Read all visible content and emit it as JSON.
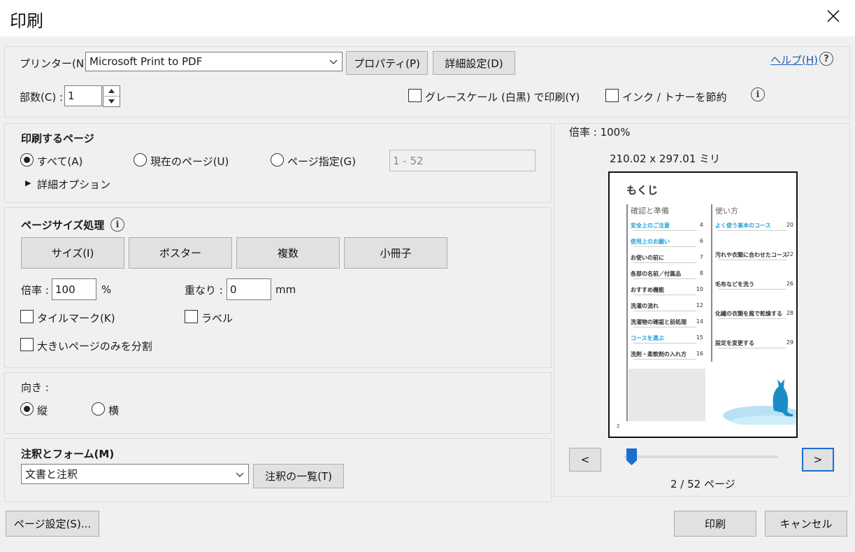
{
  "window": {
    "title": "印刷",
    "close_glyph": "✕"
  },
  "printer": {
    "label": "プリンター(N) :",
    "selected": "Microsoft Print to PDF",
    "properties_button": "プロパティ(P)",
    "advanced_button": "詳細設定(D)",
    "help_link": "ヘルプ(H)",
    "help_glyph": "?"
  },
  "copies": {
    "label": "部数(C) :",
    "value": "1"
  },
  "options": {
    "grayscale_label": "グレースケール (白黒) で印刷(Y)",
    "grayscale_checked": false,
    "save_ink_label": "インク / トナーを節約",
    "save_ink_checked": false,
    "info_glyph": "i"
  },
  "pages_to_print": {
    "heading": "印刷するページ",
    "all_label": "すべて(A)",
    "current_label": "現在のページ(U)",
    "range_label": "ページ指定(G)",
    "range_value": "1 - 52",
    "selected": "all",
    "more_options_label": "詳細オプション",
    "more_options_glyph": "▶"
  },
  "page_sizing": {
    "heading": "ページサイズ処理",
    "tabs": [
      "サイズ(I)",
      "ポスター",
      "複数",
      "小冊子"
    ],
    "scale_label": "倍率 :",
    "scale_value": "100",
    "scale_unit": "%",
    "overlap_label": "重なり :",
    "overlap_value": "0",
    "overlap_unit": "mm",
    "tile_marks_label": "タイルマーク(K)",
    "labels_label": "ラベル",
    "split_large_label": "大きいページのみを分割"
  },
  "orientation": {
    "heading": "向き :",
    "portrait_label": "縦",
    "landscape_label": "横",
    "selected": "portrait"
  },
  "comments": {
    "heading": "注釈とフォーム(M)",
    "selected": "文書と注釈",
    "summarize_button": "注釈の一覧(T)"
  },
  "preview": {
    "zoom_label": "倍率 : 100%",
    "dimensions": "210.02 x 297.01 ミリ",
    "prev_button": "<",
    "next_button": ">",
    "page_indicator": "2 / 52 ページ",
    "slider_position": 0.05,
    "page_number": "2",
    "doc": {
      "title": "もくじ",
      "left_heading": "確認と準備",
      "right_heading": "使い方",
      "left_items": [
        {
          "text": "安全上のご注意",
          "page": "4",
          "cyan": true
        },
        {
          "text": "使用上のお願い",
          "page": "6",
          "cyan": true
        },
        {
          "text": "お使いの前に",
          "page": "7",
          "cyan": false
        },
        {
          "text": "各部の名前／付属品",
          "page": "8",
          "cyan": false
        },
        {
          "text": "おすすめ機能",
          "page": "10",
          "cyan": false
        },
        {
          "text": "洗濯の流れ",
          "page": "12",
          "cyan": false
        },
        {
          "text": "洗濯物の確認と前処理",
          "page": "14",
          "cyan": false
        },
        {
          "text": "コースを選ぶ",
          "page": "15",
          "cyan": true
        },
        {
          "text": "洗剤・柔軟剤の入れ方",
          "page": "16",
          "cyan": false
        }
      ],
      "right_items": [
        {
          "text": "よく使う基本のコース",
          "page": "20",
          "cyan": true
        },
        {
          "text": "汚れや衣類に合わせたコース",
          "page": "22",
          "cyan": false
        },
        {
          "text": "毛布などを洗う",
          "page": "26",
          "cyan": false
        },
        {
          "text": "化繊の衣類を風で乾燥する",
          "page": "28",
          "cyan": false
        },
        {
          "text": "設定を変更する",
          "page": "29",
          "cyan": false
        }
      ]
    }
  },
  "footer": {
    "page_setup_button": "ページ設定(S)...",
    "print_button": "印刷",
    "cancel_button": "キャンセル"
  }
}
